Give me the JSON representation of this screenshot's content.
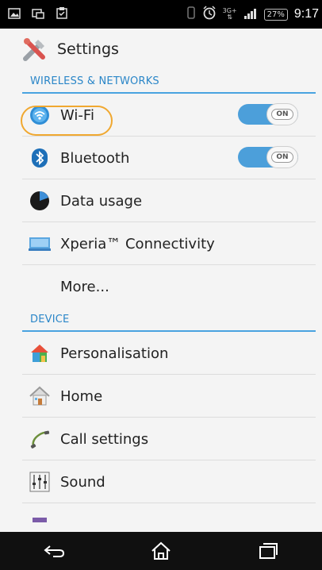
{
  "status_bar": {
    "time": "9:17",
    "battery": "27%",
    "network": "3G+",
    "icons": [
      "gallery-icon",
      "screen-icon",
      "clipboard-icon",
      "vibrate-icon",
      "alarm-icon",
      "signal-icon"
    ]
  },
  "action_bar": {
    "title": "Settings",
    "icon": "settings-tools-icon"
  },
  "sections": {
    "wireless_header": "WIRELESS & NETWORKS",
    "device_header": "DEVICE"
  },
  "wireless_items": [
    {
      "label": "Wi-Fi",
      "icon": "wifi-icon",
      "toggle": "ON"
    },
    {
      "label": "Bluetooth",
      "icon": "bluetooth-icon",
      "toggle": "ON"
    },
    {
      "label": "Data usage",
      "icon": "data-usage-icon"
    },
    {
      "label": "Xperia™ Connectivity",
      "icon": "xperia-connectivity-icon"
    },
    {
      "label": "More...",
      "icon": ""
    }
  ],
  "device_items": [
    {
      "label": "Personalisation",
      "icon": "personalisation-icon"
    },
    {
      "label": "Home",
      "icon": "home-icon"
    },
    {
      "label": "Call settings",
      "icon": "phone-handset-icon"
    },
    {
      "label": "Sound",
      "icon": "sound-sliders-icon"
    }
  ],
  "nav_bar": [
    "back-icon",
    "home-nav-icon",
    "recent-apps-icon"
  ],
  "colors": {
    "accent": "#2a86c8",
    "toggle_on": "#4c9fda",
    "highlight": "#f0a830"
  }
}
